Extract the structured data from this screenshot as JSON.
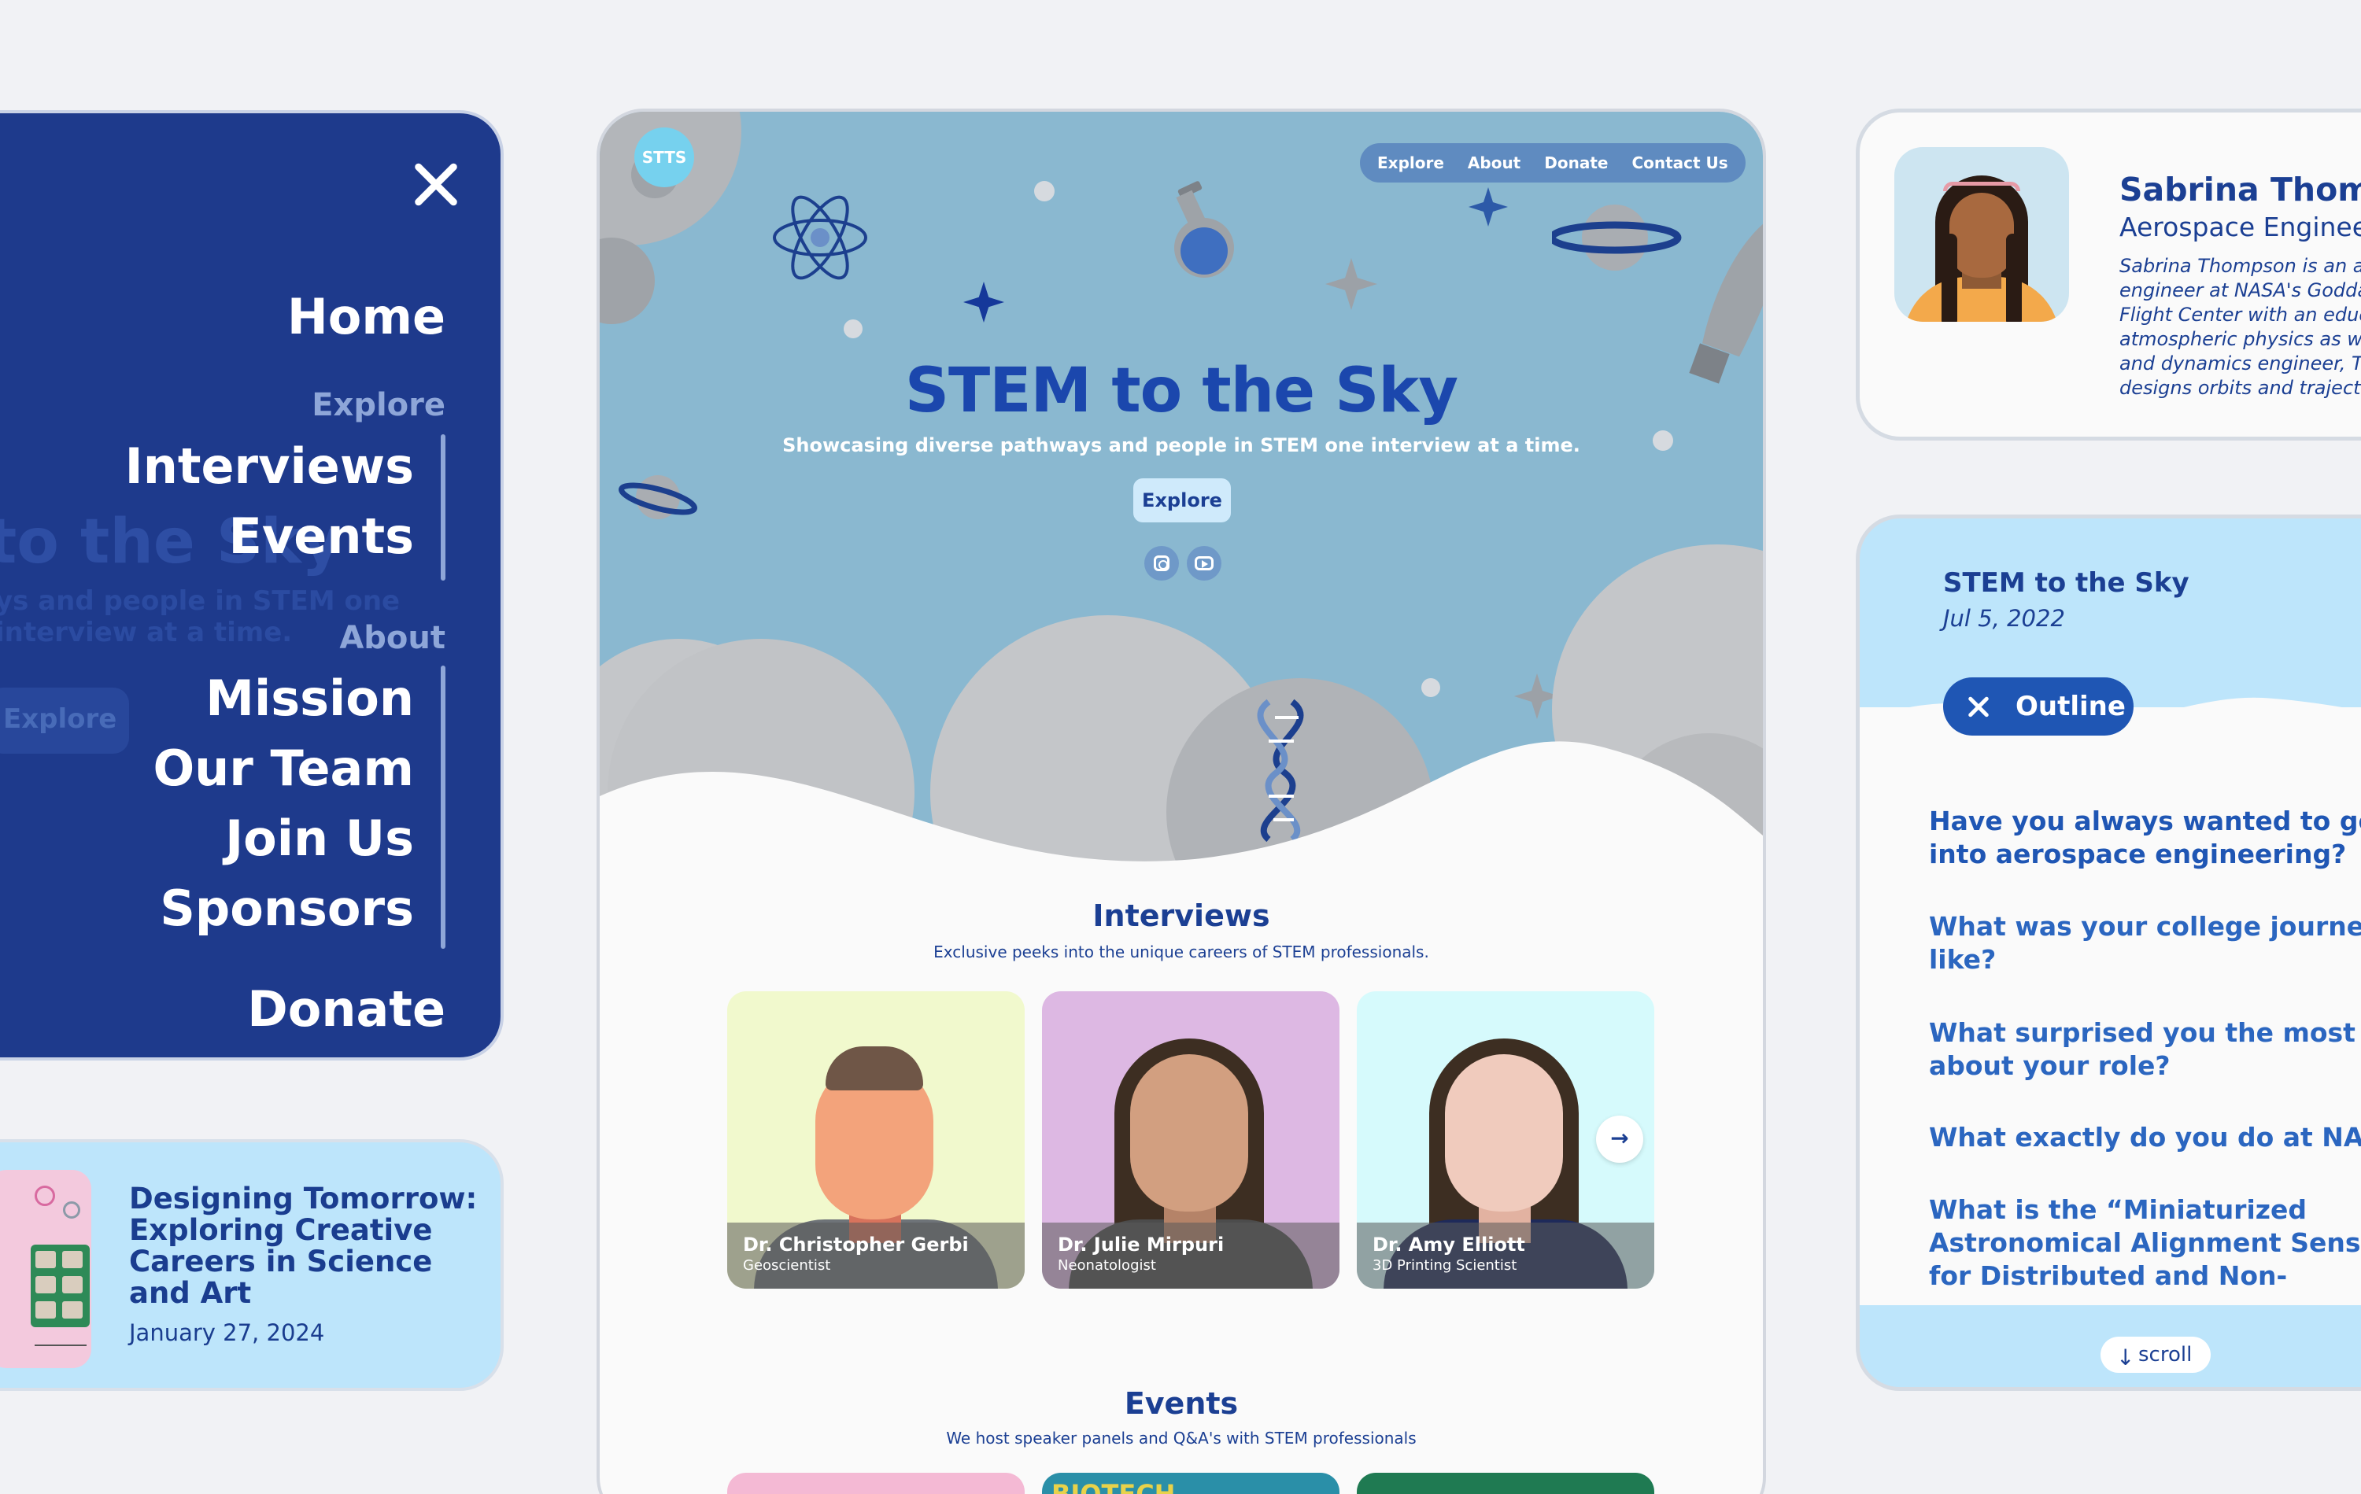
{
  "nav_menu": {
    "background_hint": {
      "title": "to the Sky",
      "subtitle": "ys and people in STEM one interview at a time.",
      "button": "Explore"
    },
    "home": "Home",
    "explore_label": "Explore",
    "explore_items": [
      "Interviews",
      "Events"
    ],
    "about_label": "About",
    "about_items": [
      "Mission",
      "Our Team",
      "Join Us",
      "Sponsors"
    ],
    "donate": "Donate",
    "close_icon": "close-icon",
    "bg_color": "#1e3a8c"
  },
  "event_card": {
    "title": "Designing Tomorrow: Exploring Creative Careers in Science and Art",
    "date": "January 27, 2024"
  },
  "site": {
    "logo_text": "STTS",
    "nav": [
      "Explore",
      "About",
      "Donate",
      "Contact Us"
    ],
    "hero": {
      "title": "STEM to the Sky",
      "subtitle": "Showcasing diverse pathways and people in STEM one interview at a time.",
      "button": "Explore",
      "social_icons": [
        "instagram-icon",
        "youtube-icon"
      ]
    },
    "interviews": {
      "title": "Interviews",
      "subtitle": "Exclusive peeks into the unique careers of STEM professionals.",
      "cards": [
        {
          "name": "Dr. Christopher Gerbi",
          "role": "Geoscientist",
          "bg": "#f1f9cd"
        },
        {
          "name": "Dr. Julie Mirpuri",
          "role": "Neonatologist",
          "bg": "#ddb8e3"
        },
        {
          "name": "Dr. Amy Elliott",
          "role": "3D Printing Scientist",
          "bg": "#d6fafc"
        }
      ],
      "next_icon": "arrow-right-icon"
    },
    "events": {
      "title": "Events",
      "subtitle": "We host speaker panels and Q&A's with STEM professionals",
      "strips": [
        "",
        "BIOTECH",
        ""
      ]
    },
    "accent": "#1b47ad"
  },
  "profile": {
    "name": "Sabrina Thompson",
    "role": "Aerospace Engineer",
    "bio_lines": [
      "Sabrina Thompson is an aerospace",
      "engineer at NASA's Goddard Space",
      "Flight Center with an education in",
      "atmospheric physics as well. As a flight",
      "and dynamics engineer, Thompson",
      "designs orbits and trajectories"
    ]
  },
  "outline": {
    "title": "STEM to the Sky",
    "date": "Jul 5, 2022",
    "button": "Outline",
    "questions": [
      "Have you always wanted to go into aerospace engineering?",
      "What was your college journey like?",
      "What surprised you the most about your role?",
      "What exactly do you do at NASA?",
      "What is the “Miniaturized Astronomical Alignment Sensor for Distributed and Non-"
    ],
    "scroll_label": "scroll"
  }
}
